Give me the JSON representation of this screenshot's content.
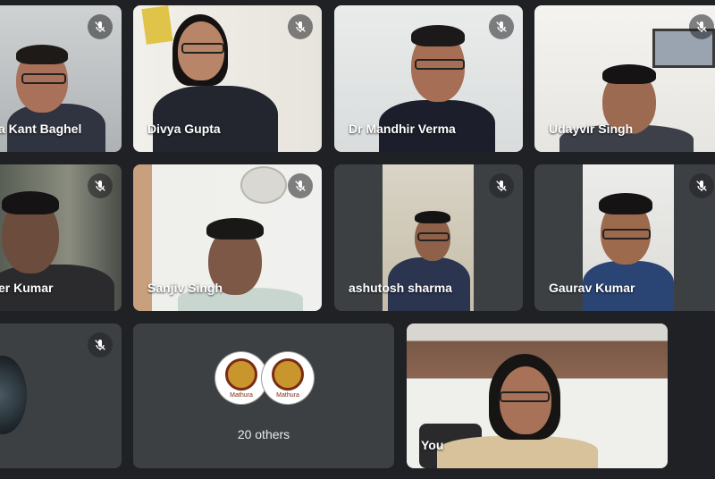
{
  "participants": [
    {
      "name": "a Kant Baghel"
    },
    {
      "name": "Divya Gupta"
    },
    {
      "name": "Dr Mandhir Verma"
    },
    {
      "name": "Udayvir Singh"
    },
    {
      "name": "er Kumar"
    },
    {
      "name": "Sanjiv Singh"
    },
    {
      "name": "ashutosh sharma"
    },
    {
      "name": "Gaurav Kumar"
    }
  ],
  "others": {
    "label": "20 others",
    "logo_text": "Mathura"
  },
  "self": {
    "label": "You"
  },
  "icons": {
    "mute": "mic-off-icon"
  }
}
